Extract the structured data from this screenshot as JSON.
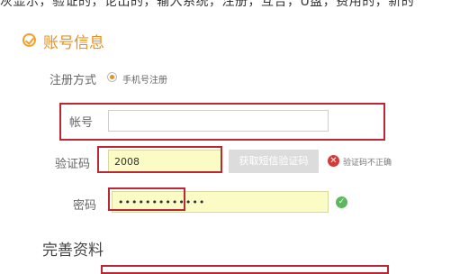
{
  "top_text": "灰显示，验证的，论出的，输入系统，注册，互合，U盘，费用的，新的",
  "title": "账号信息",
  "register_method": {
    "label": "注册方式",
    "option": "手机号注册"
  },
  "account": {
    "label": "帐号",
    "value": ""
  },
  "verify_code": {
    "label": "验证码",
    "value": "2008",
    "button": "获取短信验证码",
    "error_icon": "x-circle-icon",
    "error": "验证码不正确"
  },
  "password": {
    "label": "密码",
    "value": "•••••••••••••",
    "ok_icon": "check-circle-icon"
  },
  "section2_title": "完善资料",
  "colors": {
    "accent": "#e8901e",
    "highlight_red": "#b92833",
    "error": "#d43a3a",
    "success": "#5cb85c",
    "input_yellow": "#fbfbc6"
  }
}
